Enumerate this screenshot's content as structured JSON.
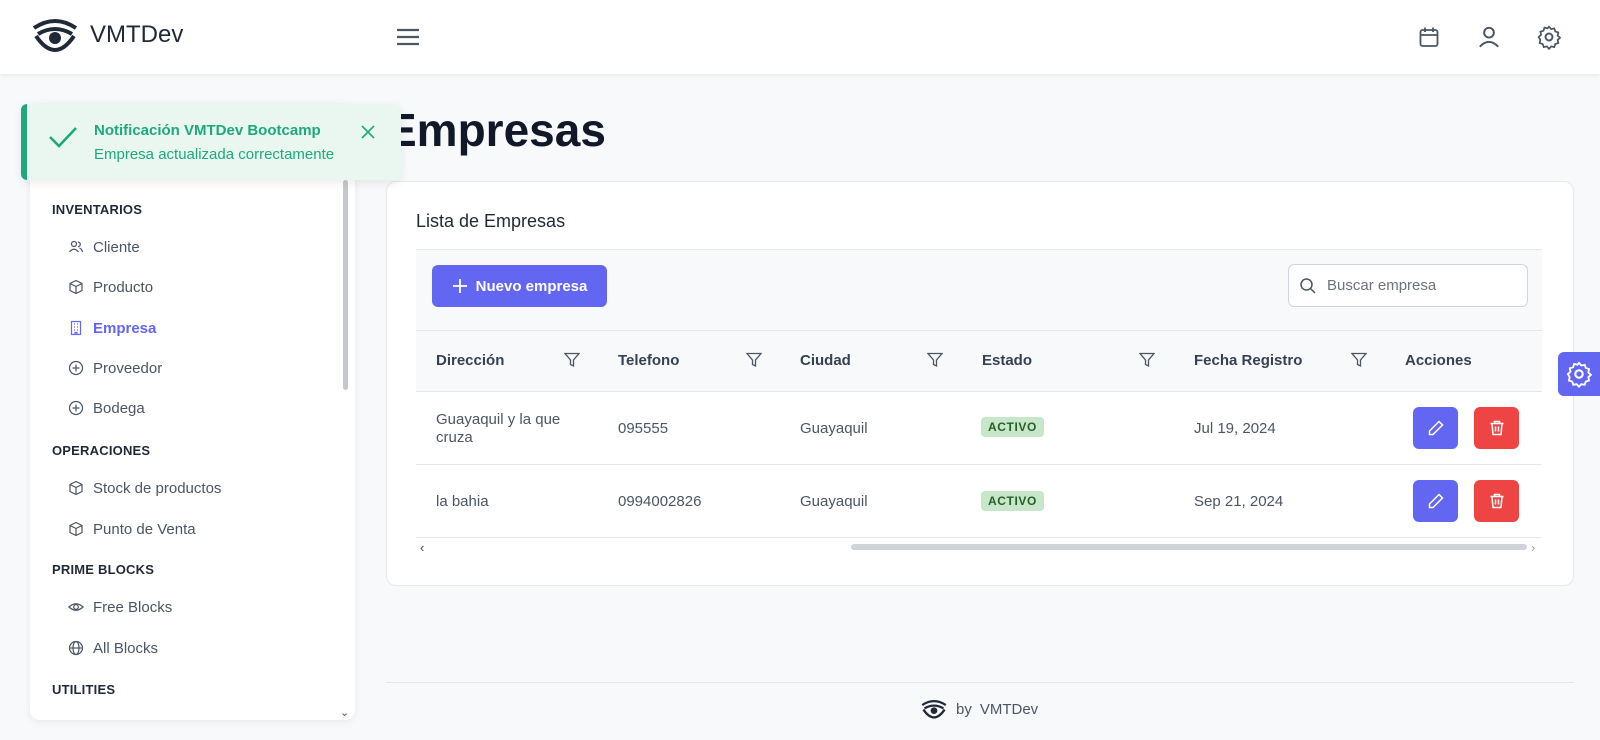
{
  "brand": {
    "name": "VMTDev"
  },
  "toast": {
    "title": "Notificación VMTDev Bootcamp",
    "message": "Empresa actualizada correctamente"
  },
  "sidebar": {
    "sections": [
      {
        "label": "INVENTARIOS",
        "items": [
          {
            "label": "Cliente",
            "icon": "users-icon"
          },
          {
            "label": "Producto",
            "icon": "box-icon"
          },
          {
            "label": "Empresa",
            "icon": "building-icon",
            "active": true
          },
          {
            "label": "Proveedor",
            "icon": "plus-circle-icon"
          },
          {
            "label": "Bodega",
            "icon": "plus-circle-icon"
          }
        ]
      },
      {
        "label": "OPERACIONES",
        "items": [
          {
            "label": "Stock de productos",
            "icon": "box-icon"
          },
          {
            "label": "Punto de Venta",
            "icon": "box-icon"
          }
        ]
      },
      {
        "label": "PRIME BLOCKS",
        "items": [
          {
            "label": "Free Blocks",
            "icon": "eye-icon"
          },
          {
            "label": "All Blocks",
            "icon": "globe-icon"
          }
        ]
      },
      {
        "label": "UTILITIES",
        "items": []
      }
    ]
  },
  "main": {
    "title": "Empresas",
    "card_title": "Lista de Empresas",
    "new_button": "Nuevo empresa",
    "search_placeholder": "Buscar empresa",
    "columns": [
      "Dirección",
      "Telefono",
      "Ciudad",
      "Estado",
      "Fecha Registro",
      "Acciones"
    ],
    "rows": [
      {
        "direccion": "Guayaquil y la que cruza",
        "telefono": "095555",
        "ciudad": "Guayaquil",
        "estado": "ACTIVO",
        "fecha": "Jul 19, 2024"
      },
      {
        "direccion": "la bahia",
        "telefono": "0994002826",
        "ciudad": "Guayaquil",
        "estado": "ACTIVO",
        "fecha": "Sep 21, 2024"
      }
    ]
  },
  "footer": {
    "by": "by",
    "brand": "VMTDev"
  },
  "colors": {
    "primary": "#6366f1",
    "danger": "#ef4444",
    "success": "#1ea97c",
    "badge_bg": "#c8e6c9",
    "badge_text": "#256029"
  }
}
